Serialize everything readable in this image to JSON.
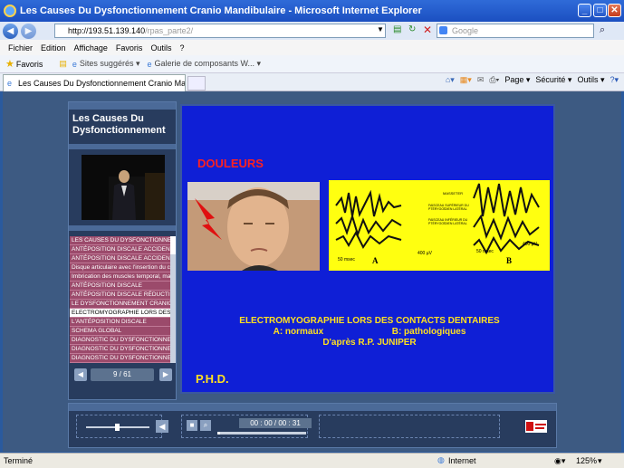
{
  "browser": {
    "window_title": "Les Causes Du Dysfonctionnement Cranio Mandibulaire - Microsoft Internet Explorer",
    "url_host": "http://193.51.139.140",
    "url_path": "/rpas_parte2/",
    "search_placeholder": "Google",
    "menu": [
      "Fichier",
      "Edition",
      "Affichage",
      "Favoris",
      "Outils",
      "?"
    ],
    "favorites_label": "Favoris",
    "fav_links": [
      "Sites suggérés ▾",
      "Galerie de composants W... ▾"
    ],
    "tab_title": "Les Causes Du Dysfonctionnement Cranio Mandibulaire",
    "tools": [
      "Page ▾",
      "Sécurité ▾",
      "Outils ▾"
    ],
    "status_left": "Terminé",
    "status_zone": "Internet",
    "zoom": "125%"
  },
  "player": {
    "title": "Les Causes Du Dysfonctionnement",
    "chapters": [
      "LES CAUSES DU DYSFONCTIONNEMENT",
      "ANTÉPOSITION DISCALE ACCIDENTELLE",
      "ANTÉPOSITION DISCALE ACCIDENTELLE",
      "Disque articulaire avec l'insertion du chef",
      "Imbrication des muscles temporal, masséter",
      "ANTÉPOSITION DISCALE",
      "ANTÉPOSITION DISCALE RÉDUCTIBLE",
      "LE DYSFONCTIONNEMENT CRANIO",
      "ELECTROMYOGRAPHIE LORS DES",
      "L'ANTÉPOSITION DISCALE",
      "SCHEMA GLOBAL",
      "DIAGNOSTIC DU DYSFONCTIONNEMENT",
      "DIAGNOSTIC DU DYSFONCTIONNEMENT",
      "DIAGNOSTIC DU DYSFONCTIONNEMENT"
    ],
    "selected_chapter_index": 8,
    "page": "9 / 61",
    "time": "00 : 00 / 00 : 31",
    "progress": 0.01,
    "volume": 0.45
  },
  "slide": {
    "heading": "DOULEURS",
    "caption_line1": "ELECTROMYOGRAPHIE LORS DES CONTACTS DENTAIRES",
    "caption_line2a": "A: normaux",
    "caption_line2b": "B: pathologiques",
    "caption_line3": "D'après R.P. JUNIPER",
    "footer": "P.H.D.",
    "emg_labels": [
      "MASSETER",
      "FAISCEAU SUPÉRIEUR DU PTÉRYGOÏDIEN LATÉRAL",
      "FAISCEAU INFÉRIEUR DU PTÉRYGOÏDIEN LATÉRAL",
      "50 msec",
      "A",
      "400 µV",
      "50 msec",
      "B",
      "400 µV"
    ]
  }
}
